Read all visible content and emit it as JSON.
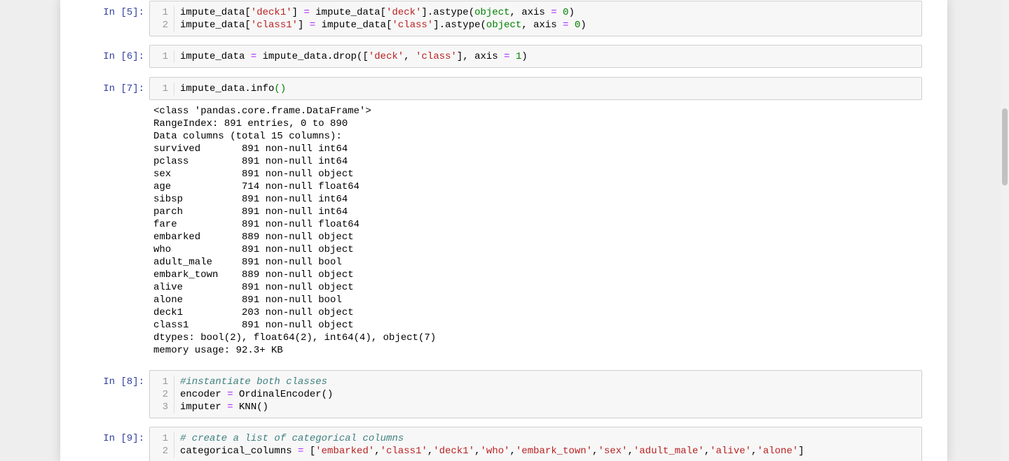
{
  "cells": [
    {
      "prompt": "In [5]:",
      "lines": [
        {
          "n": "1",
          "tokens": [
            [
              "t",
              "impute_data["
            ],
            [
              "s",
              "'deck1'"
            ],
            [
              "t",
              "] "
            ],
            [
              "o",
              "="
            ],
            [
              "t",
              " impute_data["
            ],
            [
              "s",
              "'deck'"
            ],
            [
              "t",
              "].astype("
            ],
            [
              "k",
              "object"
            ],
            [
              "t",
              ", axis "
            ],
            [
              "o",
              "="
            ],
            [
              "t",
              " "
            ],
            [
              "n",
              "0"
            ],
            [
              "t",
              ")"
            ]
          ]
        },
        {
          "n": "2",
          "tokens": [
            [
              "t",
              "impute_data["
            ],
            [
              "s",
              "'class1'"
            ],
            [
              "t",
              "] "
            ],
            [
              "o",
              "="
            ],
            [
              "t",
              " impute_data["
            ],
            [
              "s",
              "'class'"
            ],
            [
              "t",
              "].astype("
            ],
            [
              "k",
              "object"
            ],
            [
              "t",
              ", axis "
            ],
            [
              "o",
              "="
            ],
            [
              "t",
              " "
            ],
            [
              "n",
              "0"
            ],
            [
              "t",
              ")"
            ]
          ]
        }
      ]
    },
    {
      "prompt": "In [6]:",
      "lines": [
        {
          "n": "1",
          "tokens": [
            [
              "t",
              "impute_data "
            ],
            [
              "o",
              "="
            ],
            [
              "t",
              " impute_data.drop(["
            ],
            [
              "s",
              "'deck'"
            ],
            [
              "t",
              ", "
            ],
            [
              "s",
              "'class'"
            ],
            [
              "t",
              "], axis "
            ],
            [
              "o",
              "="
            ],
            [
              "t",
              " "
            ],
            [
              "n",
              "1"
            ],
            [
              "t",
              ")"
            ]
          ]
        }
      ]
    },
    {
      "prompt": "In [7]:",
      "lines": [
        {
          "n": "1",
          "tokens": [
            [
              "t",
              "impute_data.info"
            ],
            [
              "k",
              "()"
            ]
          ]
        }
      ],
      "output": [
        "<class 'pandas.core.frame.DataFrame'>",
        "RangeIndex: 891 entries, 0 to 890",
        "Data columns (total 15 columns):",
        "survived       891 non-null int64",
        "pclass         891 non-null int64",
        "sex            891 non-null object",
        "age            714 non-null float64",
        "sibsp          891 non-null int64",
        "parch          891 non-null int64",
        "fare           891 non-null float64",
        "embarked       889 non-null object",
        "who            891 non-null object",
        "adult_male     891 non-null bool",
        "embark_town    889 non-null object",
        "alive          891 non-null object",
        "alone          891 non-null bool",
        "deck1          203 non-null object",
        "class1         891 non-null object",
        "dtypes: bool(2), float64(2), int64(4), object(7)",
        "memory usage: 92.3+ KB"
      ]
    },
    {
      "prompt": "In [8]:",
      "lines": [
        {
          "n": "1",
          "tokens": [
            [
              "c",
              "#instantiate both classes"
            ]
          ]
        },
        {
          "n": "2",
          "tokens": [
            [
              "t",
              "encoder "
            ],
            [
              "o",
              "="
            ],
            [
              "t",
              " OrdinalEncoder()"
            ]
          ]
        },
        {
          "n": "3",
          "tokens": [
            [
              "t",
              "imputer "
            ],
            [
              "o",
              "="
            ],
            [
              "t",
              " KNN()"
            ]
          ]
        }
      ]
    },
    {
      "prompt": "In [9]:",
      "lines": [
        {
          "n": "1",
          "tokens": [
            [
              "c",
              "# create a list of categorical columns"
            ]
          ]
        },
        {
          "n": "2",
          "tokens": [
            [
              "t",
              "categorical_columns "
            ],
            [
              "o",
              "="
            ],
            [
              "t",
              " ["
            ],
            [
              "s",
              "'embarked'"
            ],
            [
              "t",
              ","
            ],
            [
              "s",
              "'class1'"
            ],
            [
              "t",
              ","
            ],
            [
              "s",
              "'deck1'"
            ],
            [
              "t",
              ","
            ],
            [
              "s",
              "'who'"
            ],
            [
              "t",
              ","
            ],
            [
              "s",
              "'embark_town'"
            ],
            [
              "t",
              ","
            ],
            [
              "s",
              "'sex'"
            ],
            [
              "t",
              ","
            ],
            [
              "s",
              "'adult_male'"
            ],
            [
              "t",
              ","
            ],
            [
              "s",
              "'alive'"
            ],
            [
              "t",
              ","
            ],
            [
              "s",
              "'alone'"
            ],
            [
              "t",
              "]"
            ]
          ]
        }
      ]
    }
  ]
}
